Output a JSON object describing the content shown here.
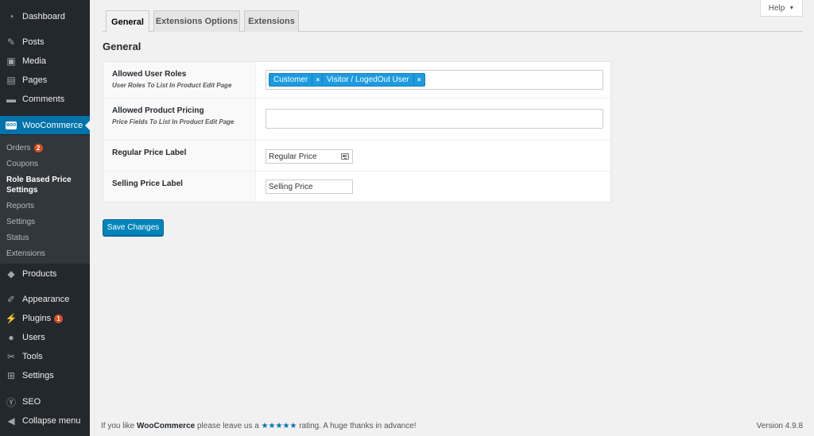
{
  "sidebar": {
    "items": [
      {
        "label": "Dashboard",
        "icon": "dashboard-icon"
      },
      {
        "label": "Posts",
        "icon": "pin-icon"
      },
      {
        "label": "Media",
        "icon": "media-icon"
      },
      {
        "label": "Pages",
        "icon": "pages-icon"
      },
      {
        "label": "Comments",
        "icon": "comments-icon"
      },
      {
        "label": "WooCommerce",
        "icon": "woocommerce-icon"
      },
      {
        "label": "Products",
        "icon": "products-icon"
      },
      {
        "label": "Appearance",
        "icon": "appearance-icon"
      },
      {
        "label": "Plugins",
        "icon": "plugins-icon",
        "badge": "1"
      },
      {
        "label": "Users",
        "icon": "users-icon"
      },
      {
        "label": "Tools",
        "icon": "tools-icon"
      },
      {
        "label": "Settings",
        "icon": "settings-icon"
      },
      {
        "label": "SEO",
        "icon": "seo-icon"
      },
      {
        "label": "Collapse menu",
        "icon": "collapse-icon"
      }
    ],
    "woo_logo_text": "WOO",
    "submenu": [
      {
        "label": "Orders",
        "badge": "2"
      },
      {
        "label": "Coupons"
      },
      {
        "label": "Role Based Price Settings"
      },
      {
        "label": "Reports"
      },
      {
        "label": "Settings"
      },
      {
        "label": "Status"
      },
      {
        "label": "Extensions"
      }
    ]
  },
  "help": {
    "label": "Help",
    "arrow": "▼"
  },
  "tabs": [
    {
      "label": "General"
    },
    {
      "label": "Extensions Options"
    },
    {
      "label": "Extensions"
    }
  ],
  "section_title": "General",
  "form": {
    "rows": [
      {
        "label": "Allowed User Roles",
        "desc": "User Roles To List In Product Edit Page"
      },
      {
        "label": "Allowed Product Pricing",
        "desc": "Price Fields To List In Product Edit Page"
      },
      {
        "label": "Regular Price Label",
        "value": "Regular Price"
      },
      {
        "label": "Selling Price Label",
        "value": "Selling Price"
      }
    ],
    "roles": [
      "Customer",
      "Visitor / LogedOut User"
    ],
    "remove_symbol": "×"
  },
  "save_label": "Save Changes",
  "footer": {
    "prefix": "If you like ",
    "brand": "WooCommerce",
    "middle": " please leave us a ",
    "stars": "★★★★★",
    "suffix": " rating. A huge thanks in advance!",
    "version": "Version 4.9.8"
  },
  "colors": {
    "accent": "#0073aa",
    "button": "#0085ba",
    "chip": "#1c9be0",
    "badge": "#d54e21",
    "sidebar": "#23282d"
  }
}
